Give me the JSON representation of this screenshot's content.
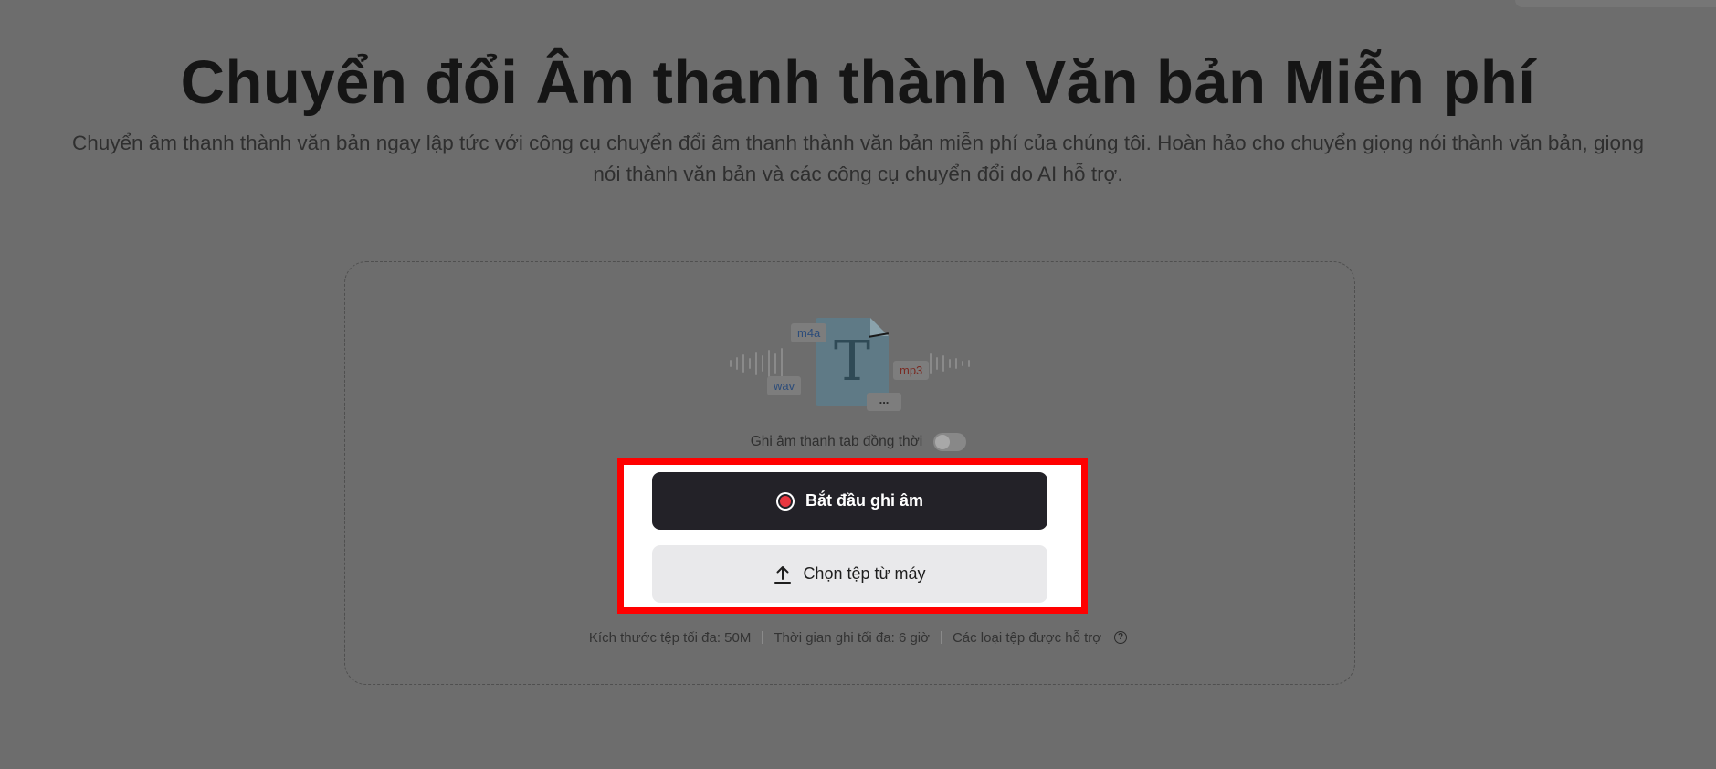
{
  "hero": {
    "title": "Chuyển đổi Âm thanh thành Văn bản Miễn phí",
    "subtitle_line1": "Chuyển âm thanh thành văn bản ngay lập tức với công cụ chuyển đổi âm thanh thành văn bản miễn phí của chúng tôi. Hoàn hảo cho chuyển giọng nói thành văn bản, giọng",
    "subtitle_line2": "nói thành văn bản và các công cụ chuyển đổi do AI hỗ trợ."
  },
  "illustration": {
    "doc_letter": "T",
    "tags": [
      "m4a",
      "wav",
      "mp3",
      "..."
    ]
  },
  "uploader": {
    "toggle_label": "Ghi âm thanh tab đồng thời",
    "toggle_on": false,
    "record_button": "Bắt đầu ghi âm",
    "upload_button": "Chọn tệp từ máy",
    "info": {
      "max_size": "Kích thước tệp tối đa: 50M",
      "max_duration": "Thời gian ghi tối đa: 6 giờ",
      "supported_types": "Các loại tệp được hỗ trợ",
      "help_glyph": "?"
    }
  },
  "colors": {
    "highlight": "#ff0000",
    "record_dot": "#e8363f",
    "record_button_bg": "#232228",
    "overlay_bg": "#6d6d6d"
  }
}
